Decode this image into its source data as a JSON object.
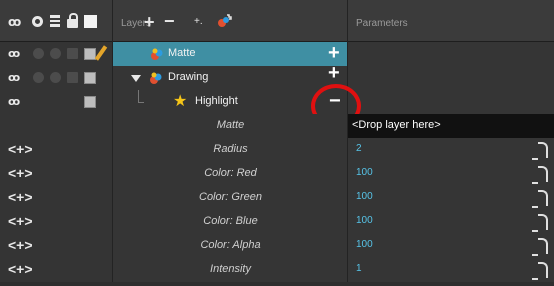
{
  "header": {
    "layers_label": "Layers",
    "parameters_label": "Parameters"
  },
  "layers": [
    {
      "name": "Matte",
      "selected": true,
      "action": "+"
    },
    {
      "name": "Drawing",
      "selected": false,
      "action": "+"
    },
    {
      "name": "Highlight",
      "selected": false,
      "action": "−"
    }
  ],
  "parameters": [
    {
      "name": "Matte",
      "value": "<Drop layer here>"
    },
    {
      "name": "Radius",
      "value": "2"
    },
    {
      "name": "Color: Red",
      "value": "100"
    },
    {
      "name": "Color: Green",
      "value": "100"
    },
    {
      "name": "Color: Blue",
      "value": "100"
    },
    {
      "name": "Color: Alpha",
      "value": "100"
    },
    {
      "name": "Intensity",
      "value": "1"
    }
  ],
  "glyphs": {
    "arrows": "<+>",
    "eye": "ꝏ",
    "add": "+",
    "remove": "−",
    "add_peg": "+.",
    "star": "★"
  },
  "colors": {
    "selection": "#3f8fa3",
    "value_text": "#57c4e8",
    "highlight_circle": "#e01010",
    "star": "#f5c518"
  },
  "icons": [
    "eye-icon",
    "onion-skin-icon",
    "layers-stack-icon",
    "lock-icon",
    "color-swatch-icon",
    "pencil-icon",
    "effect-icon",
    "star-icon",
    "function-curve-icon"
  ]
}
